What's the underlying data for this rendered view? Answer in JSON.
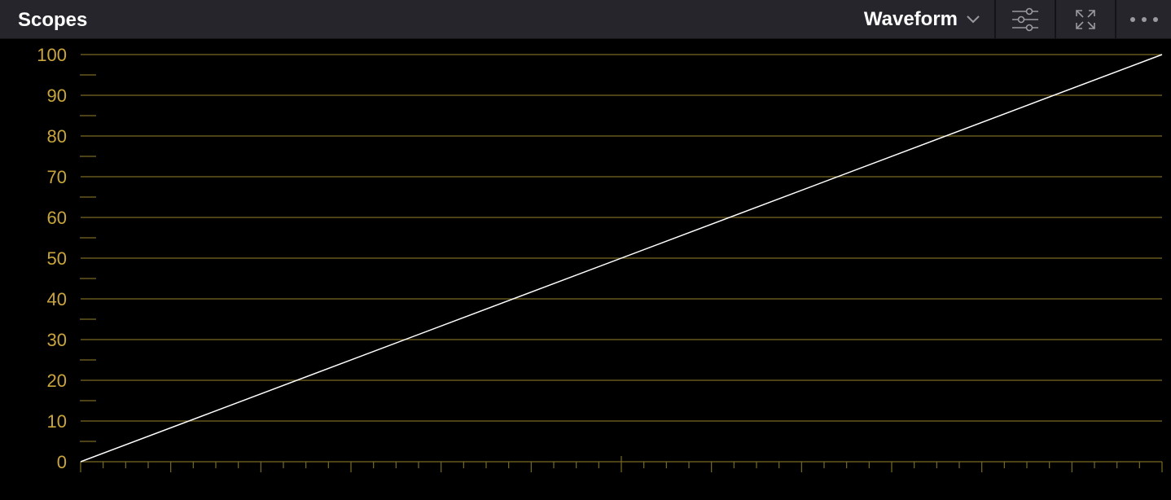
{
  "header": {
    "title": "Scopes",
    "mode_label": "Waveform",
    "icons": {
      "mode_dropdown": "chevron-down-icon",
      "settings": "sliders-icon",
      "expand": "expand-icon",
      "more": "more-dots-icon"
    }
  },
  "colors": {
    "header_bg": "#25252b",
    "scope_bg": "#000000",
    "graticule": "#7a6a24",
    "axis_label": "#c9a53c",
    "trace": "#ffffff"
  },
  "chart_data": {
    "type": "line",
    "y_ticks": [
      "0",
      "10",
      "20",
      "30",
      "40",
      "50",
      "60",
      "70",
      "80",
      "90",
      "100"
    ],
    "ylim": [
      0,
      100
    ],
    "xlim": [
      0,
      1
    ],
    "grid": true,
    "series": [
      {
        "x": [
          0,
          1
        ],
        "values": [
          0,
          100
        ]
      }
    ]
  }
}
